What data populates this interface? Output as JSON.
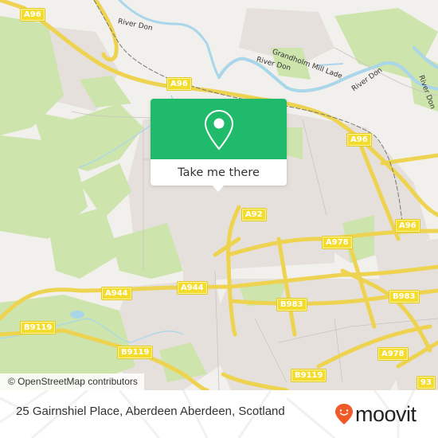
{
  "map": {
    "colors": {
      "background": "#f2f0ec",
      "urban": "#e6e0dc",
      "park": "#cde4ad",
      "water": "#a9d6ea",
      "road_major": "#f5e17a",
      "road_minor": "#ffffff",
      "rail": "#777777"
    },
    "road_labels": [
      {
        "id": "a96-nw",
        "text": "A96"
      },
      {
        "id": "a96-center",
        "text": "A96"
      },
      {
        "id": "a96-east",
        "text": "A96"
      },
      {
        "id": "a96-far-east",
        "text": "A96"
      },
      {
        "id": "a92",
        "text": "A92"
      },
      {
        "id": "a978-upper",
        "text": "A978"
      },
      {
        "id": "a944-west",
        "text": "A944"
      },
      {
        "id": "a944-east",
        "text": "A944"
      },
      {
        "id": "b983-center",
        "text": "B983"
      },
      {
        "id": "b983-east",
        "text": "B983"
      },
      {
        "id": "b9119-west",
        "text": "B9119"
      },
      {
        "id": "b9119-center",
        "text": "B9119"
      },
      {
        "id": "b9119-south",
        "text": "B9119"
      },
      {
        "id": "a978-lower",
        "text": "A978"
      },
      {
        "id": "a93-partial",
        "text": "93"
      }
    ],
    "water_labels": [
      {
        "id": "river-don-1",
        "text": "River Don"
      },
      {
        "id": "river-don-2",
        "text": "River Don"
      },
      {
        "id": "grandholm-mill-lade",
        "text": "Grandholm Mill Lade"
      },
      {
        "id": "river-don-3",
        "text": "River Don"
      },
      {
        "id": "river-don-4",
        "text": "River Don"
      }
    ]
  },
  "popup": {
    "icon": "map-pin-icon",
    "accent_color": "#1fba6a",
    "button_label": "Take me there"
  },
  "attribution": "© OpenStreetMap contributors",
  "footer": {
    "address": "25 Gairnshiel Place, Aberdeen Aberdeen, Scotland",
    "brand": {
      "name": "moovit",
      "logo_icon": "moovit-smiley-pin-icon",
      "logo_color": "#f05a28"
    }
  }
}
